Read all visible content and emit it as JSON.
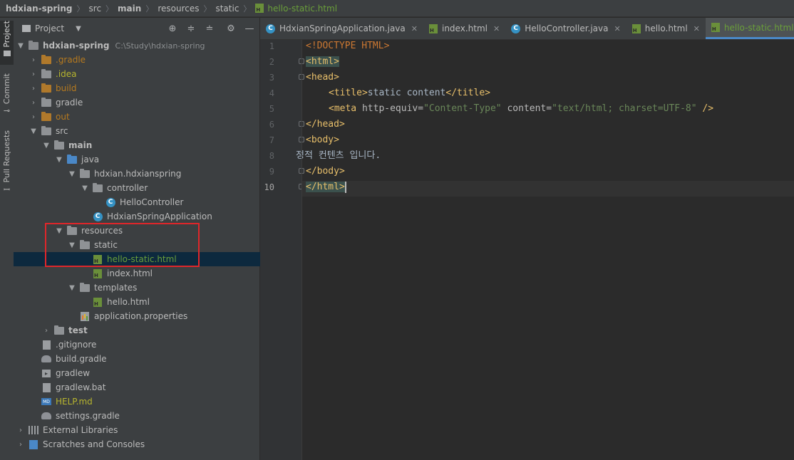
{
  "breadcrumb": [
    "hdxian-spring",
    "src",
    "main",
    "resources",
    "static",
    "hello-static.html"
  ],
  "side_tabs": [
    "Project",
    "Commit",
    "Pull Requests"
  ],
  "project_panel": {
    "title": "Project",
    "tree": [
      {
        "label": "hdxian-spring",
        "path": "C:\\Study\\hdxian-spring"
      },
      {
        "label": ".gradle"
      },
      {
        "label": ".idea"
      },
      {
        "label": "build"
      },
      {
        "label": "gradle"
      },
      {
        "label": "out"
      },
      {
        "label": "src"
      },
      {
        "label": "main"
      },
      {
        "label": "java"
      },
      {
        "label": "hdxian.hdxianspring"
      },
      {
        "label": "controller"
      },
      {
        "label": "HelloController"
      },
      {
        "label": "HdxianSpringApplication"
      },
      {
        "label": "resources"
      },
      {
        "label": "static"
      },
      {
        "label": "hello-static.html"
      },
      {
        "label": "index.html"
      },
      {
        "label": "templates"
      },
      {
        "label": "hello.html"
      },
      {
        "label": "application.properties"
      },
      {
        "label": "test"
      },
      {
        "label": ".gitignore"
      },
      {
        "label": "build.gradle"
      },
      {
        "label": "gradlew"
      },
      {
        "label": "gradlew.bat"
      },
      {
        "label": "HELP.md"
      },
      {
        "label": "settings.gradle"
      },
      {
        "label": "External Libraries"
      },
      {
        "label": "Scratches and Consoles"
      }
    ]
  },
  "editor_tabs": [
    {
      "label": "HdxianSpringApplication.java"
    },
    {
      "label": "index.html"
    },
    {
      "label": "HelloController.java"
    },
    {
      "label": "hello.html"
    },
    {
      "label": "hello-static.html"
    }
  ],
  "editor": {
    "line_numbers": [
      "1",
      "2",
      "3",
      "4",
      "5",
      "6",
      "7",
      "8",
      "9",
      "10"
    ],
    "lines": {
      "l1_doctype": "<!DOCTYPE HTML>",
      "l2_open": "<html>",
      "l3_open": "<head>",
      "l4_title_open": "<title>",
      "l4_title_text": "static content",
      "l4_title_close": "</title>",
      "l5_meta_open": "<meta",
      "l5_attr1": "http-equiv=",
      "l5_val1": "\"Content-Type\"",
      "l5_attr2": "content=",
      "l5_val2": "\"text/html; charset=UTF-8\"",
      "l5_close": "/>",
      "l6_close": "</head>",
      "l7_open": "<body>",
      "l8_text": "정적 컨텐츠 입니다.",
      "l9_close": "</body>",
      "l10_close": "</html>"
    }
  }
}
